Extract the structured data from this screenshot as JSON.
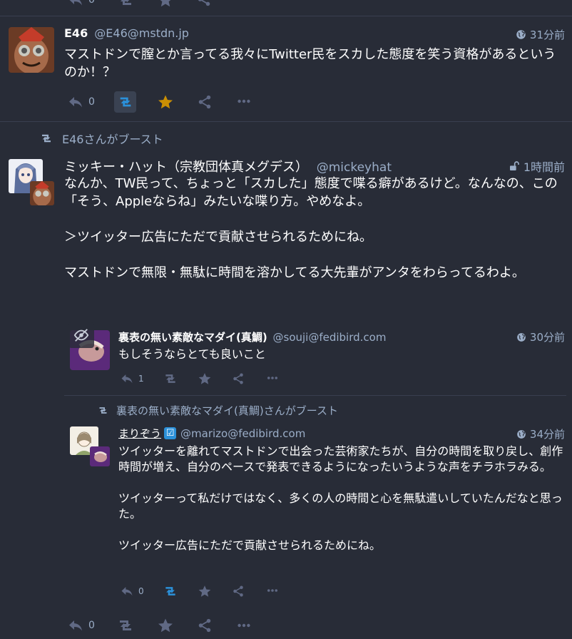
{
  "top_bar": {
    "reply_count": "0"
  },
  "post1": {
    "display_name": "E46",
    "acct": "@E46@mstdn.jp",
    "time": "31分前",
    "content": "マストドンで膣とか言ってる我々にTwitter民をスカした態度を笑う資格があるというのか！？",
    "reply_count": "0"
  },
  "boost1": {
    "label": "E46さんがブースト"
  },
  "post2": {
    "display_name": "ミッキー・ハット（宗教団体真メグデス）",
    "acct": "@mickeyhat",
    "time": "1時間前",
    "paragraphs": [
      "なんか、TW民って、ちょっと「スカした」態度で喋る癖があるけど。なんなの、この「そう、Appleならね」みたいな喋り方。やめなよ。",
      "＞ツイッター広告にただで貢献させられるためにね。",
      "マストドンで無限・無駄に時間を溶かしてる大先輩がアンタをわらってるわよ。"
    ],
    "reply_count": "0"
  },
  "quote1": {
    "display_name": "裏表の無い素敵なマダイ(真鯛)",
    "acct": "@souji@fedibird.com",
    "time": "30分前",
    "content": "もしそうならとても良いこと",
    "reply_count": "1"
  },
  "boost2": {
    "label": "裏表の無い素敵なマダイ(真鯛)さんがブースト"
  },
  "quote2": {
    "display_name": "まりぞう",
    "verified": "☑",
    "acct": "@marizo@fedibird.com",
    "time": "34分前",
    "paragraphs": [
      "ツイッターを離れてマストドンで出会った芸術家たちが、自分の時間を取り戻し、創作時間が増え、自分のペースで発表できるようになったいうような声をチラホラみる。",
      "ツイッターって私だけではなく、多くの人の時間と心を無駄遣いしていたんだなと思った。",
      "ツイッター広告にただで貢献させられるためにね。"
    ],
    "reply_count": "0"
  },
  "colors": {
    "background": "#282c37",
    "icon": "#606984",
    "muted": "#9baec8",
    "boost_active": "#2b90d9",
    "favourite_active": "#ca8f04"
  }
}
